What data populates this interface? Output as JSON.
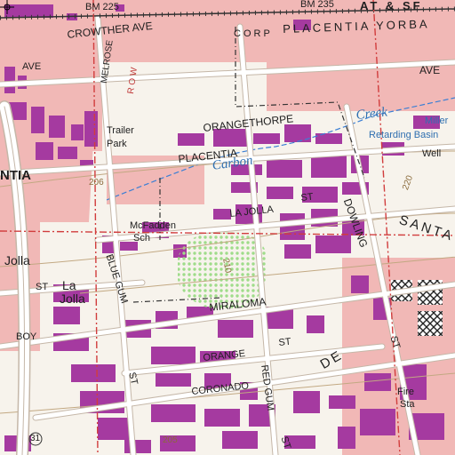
{
  "map": {
    "labels": {
      "bm225": "BM 225",
      "bm235": "BM 235",
      "ats_f": "AT & SF",
      "crowther_ave": "CROWTHER AVE",
      "corp": "CORP",
      "placentia_yorba": "PLACENTIA   YORBA",
      "melrose": "MELROSE",
      "row": "R O W",
      "ave_west": "AVE",
      "ave_east": "AVE",
      "orangethorpe": "ORANGETHORPE",
      "creek": "Creek",
      "miller": "Miller",
      "retarding_basin": "Retarding Basin",
      "well": "Well",
      "trailer_park_1": "Trailer",
      "trailer_park_2": "Park",
      "placentia_road": "PLACENTIA",
      "carbon": "Carbon",
      "ntia": "NTIA",
      "elev_206": "206",
      "elev_220": "220",
      "la_jolla_st": "LA JOLLA",
      "st_1": "ST",
      "dowling": "DOWLING",
      "santa_fe": "SANTA",
      "mcfadden_1": "McFadden",
      "mcfadden_2": "Sch",
      "jolla_1": "Jolla",
      "la_jolla_town_1": "La",
      "la_jolla_town_2": "Jolla",
      "st_2": "ST",
      "blue_gum": "BLUE GUM",
      "elev_210": "210",
      "miraloma": "MIRALOMA",
      "boy": "BOY",
      "orange_st": "ORANGE",
      "st_3": "ST",
      "red_gum": "RED GUM",
      "de_letters": "DE",
      "coronado": "CORONADO",
      "fire_sta_1": "Fire",
      "fire_sta_2": "Sta",
      "elev_205": "205",
      "st_4": "ST",
      "route_31": "31",
      "st_5": "ST",
      "st_6": "ST"
    }
  },
  "colors": {
    "background": "#f7f3ec",
    "urban_tint": "#f1b8b6",
    "building": "#a53aa0",
    "road_fill": "#ffffff",
    "road_casing": "#c5b7a8",
    "red_line": "#d13d3d",
    "contour": "#c2a882",
    "water": "#3b7fd4",
    "boundary": "#333333",
    "park_dots": "#9fdc8a"
  }
}
